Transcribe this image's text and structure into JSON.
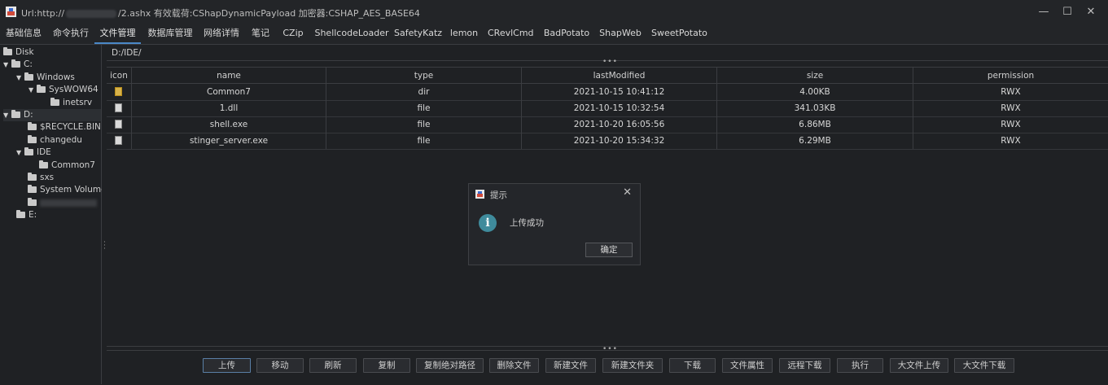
{
  "window": {
    "title_prefix": "Url:http://",
    "title_suffix": "/2.ashx 有效载荷:CShapDynamicPayload 加密器:CSHAP_AES_BASE64",
    "minimize_glyph": "—",
    "maximize_glyph": "☐",
    "close_glyph": "✕"
  },
  "tabs": [
    "基础信息",
    "命令执行",
    "文件管理",
    "数据库管理",
    "网络详情",
    "笔记",
    "CZip",
    "ShellcodeLoader",
    "SafetyKatz",
    "lemon",
    "CRevlCmd",
    "BadPotato",
    "ShapWeb",
    "SweetPotato"
  ],
  "active_tab": "文件管理",
  "tree": {
    "root": "Disk",
    "nodes": [
      {
        "label": "C:",
        "expanded": true
      },
      {
        "label": "Windows",
        "expanded": true
      },
      {
        "label": "SysWOW64",
        "expanded": true
      },
      {
        "label": "inetsrv"
      },
      {
        "label": "D:",
        "expanded": true
      },
      {
        "label": "$RECYCLE.BIN"
      },
      {
        "label": "changedu"
      },
      {
        "label": "IDE",
        "expanded": true
      },
      {
        "label": "Common7"
      },
      {
        "label": "sxs"
      },
      {
        "label": "System Volume"
      },
      {
        "label": ""
      },
      {
        "label": "E:"
      }
    ]
  },
  "path": "D:/IDE/",
  "table": {
    "columns": [
      "icon",
      "name",
      "type",
      "lastModified",
      "size",
      "permission"
    ],
    "rows": [
      {
        "kind": "dir",
        "name": "Common7",
        "type": "dir",
        "lastModified": "2021-10-15 10:41:12",
        "size": "4.00KB",
        "permission": "RWX"
      },
      {
        "kind": "file",
        "name": "1.dll",
        "type": "file",
        "lastModified": "2021-10-15 10:32:54",
        "size": "341.03KB",
        "permission": "RWX"
      },
      {
        "kind": "file",
        "name": "shell.exe",
        "type": "file",
        "lastModified": "2021-10-20 16:05:56",
        "size": "6.86MB",
        "permission": "RWX"
      },
      {
        "kind": "file",
        "name": "stinger_server.exe",
        "type": "file",
        "lastModified": "2021-10-20 15:34:32",
        "size": "6.29MB",
        "permission": "RWX"
      }
    ]
  },
  "buttons": [
    "上传",
    "移动",
    "刷新",
    "复制",
    "复制绝对路径",
    "删除文件",
    "新建文件",
    "新建文件夹",
    "下载",
    "文件属性",
    "远程下载",
    "执行",
    "大文件上传",
    "大文件下载"
  ],
  "dialog": {
    "title": "提示",
    "message": "上传成功",
    "ok": "确定",
    "close_glyph": "✕",
    "info_glyph": "i"
  },
  "colors": {
    "accent": "#4a88c7",
    "info": "#3f8b9c",
    "folder": "#d7b24a"
  }
}
